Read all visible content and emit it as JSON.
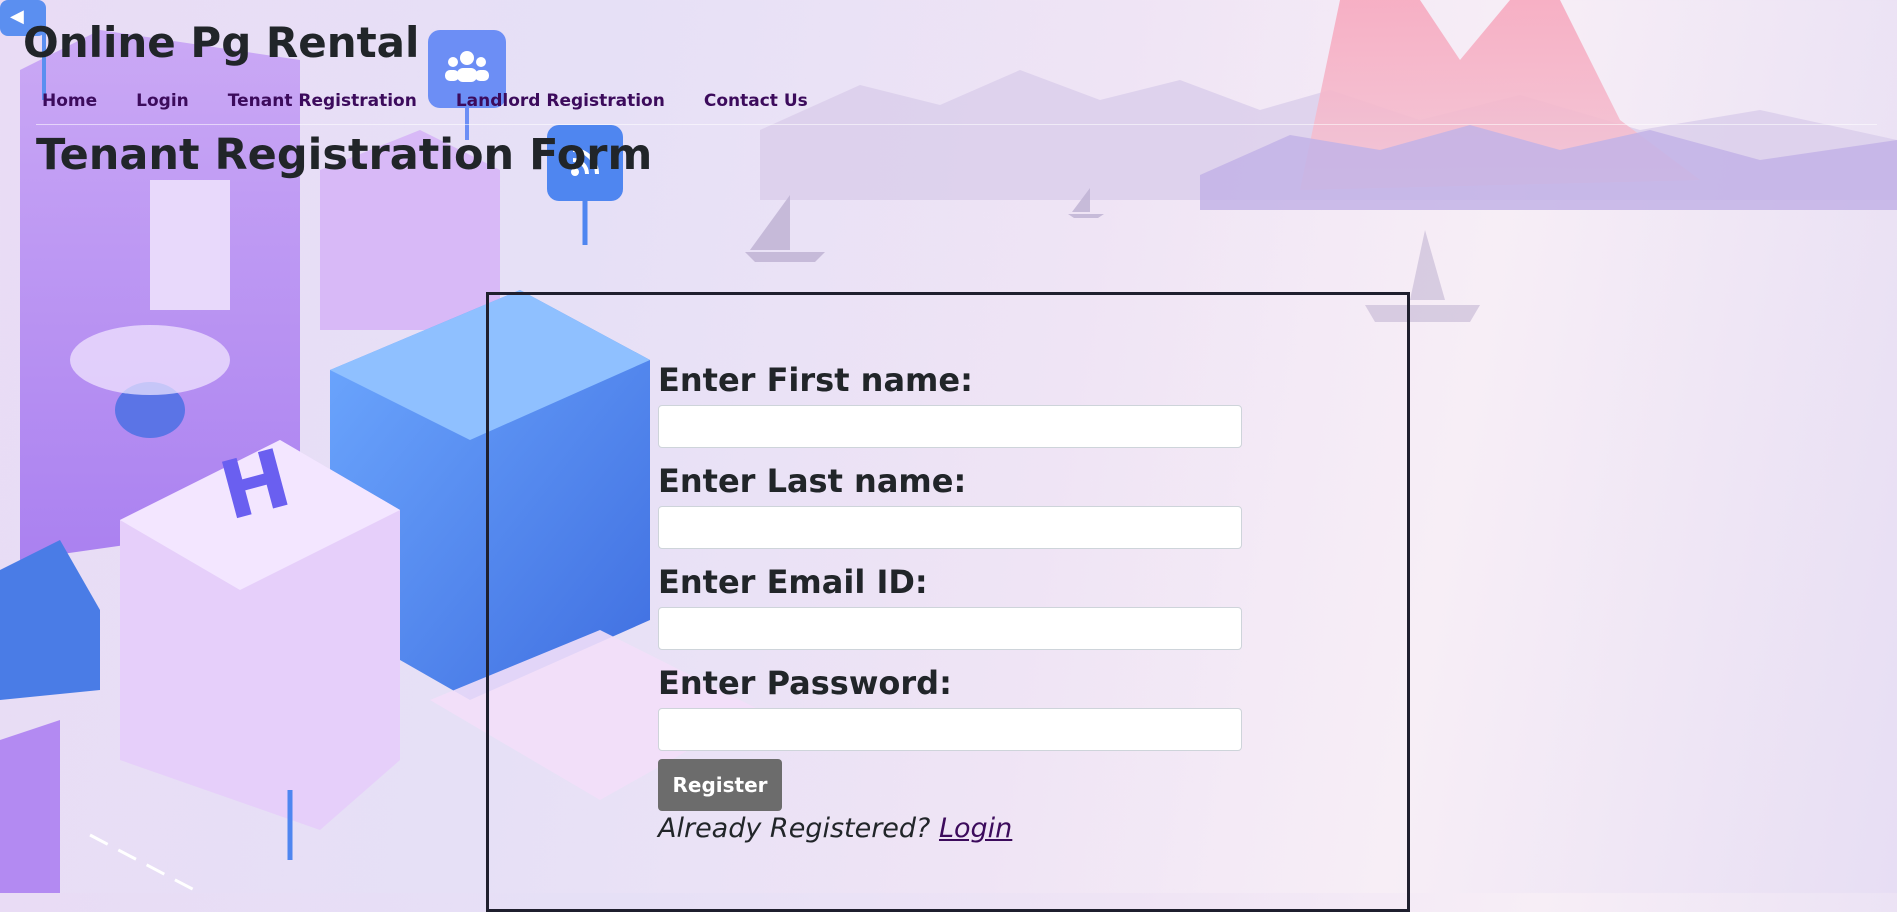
{
  "site": {
    "title": "Online Pg Rental"
  },
  "nav": {
    "items": [
      "Home",
      "Login",
      "Tenant Registration",
      "Landlord Registration",
      "Contact Us"
    ]
  },
  "page": {
    "heading": "Tenant Registration Form"
  },
  "form": {
    "fields": [
      {
        "label": "Enter First name:",
        "value": ""
      },
      {
        "label": "Enter Last name:",
        "value": ""
      },
      {
        "label": "Enter Email ID:",
        "value": ""
      },
      {
        "label": "Enter Password:",
        "value": ""
      }
    ],
    "submit_label": "Register",
    "already_text": "Already Registered?",
    "login_link": "Login"
  },
  "colors": {
    "nav_link": "#3c0b5c",
    "button": "#6c6c6c",
    "box_border": "#1f1f2e"
  },
  "icons": [
    "video-icon",
    "group-icon",
    "wifi-icon"
  ]
}
